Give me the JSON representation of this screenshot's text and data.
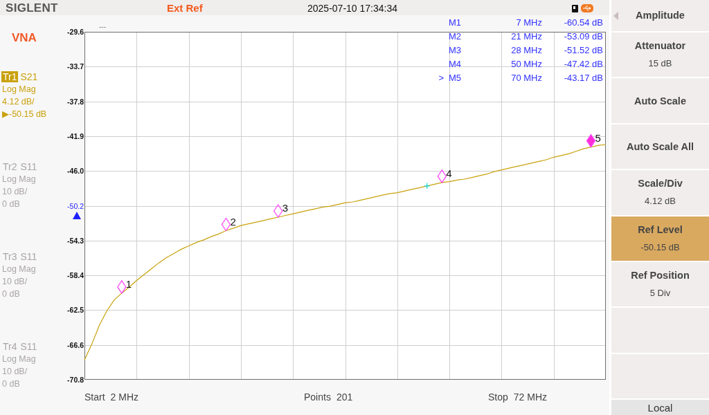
{
  "top_bar": {
    "logo": "SIGLENT",
    "reference": "Ext Ref",
    "datetime": "2025-07-10 17:34:34"
  },
  "mode": "VNA",
  "traces": [
    {
      "label": "Tr1",
      "parameter": "S21",
      "format": "Log Mag",
      "scale": "4.12 dB/",
      "reference": "▶-50.15 dB",
      "selected": true
    },
    {
      "label": "Tr2",
      "parameter": "S11",
      "format": "Log Mag",
      "scale": "10 dB/",
      "reference": "0 dB",
      "selected": false
    },
    {
      "label": "Tr3",
      "parameter": "S11",
      "format": "Log Mag",
      "scale": "10 dB/",
      "reference": "0 dB",
      "selected": false
    },
    {
      "label": "Tr4",
      "parameter": "S11",
      "format": "Log Mag",
      "scale": "10 dB/",
      "reference": "0 dB",
      "selected": false
    }
  ],
  "plot": {
    "chart_data": {
      "type": "line",
      "title": "---",
      "categories": [
        null,
        null,
        null,
        null,
        null,
        null,
        null,
        null,
        null,
        null,
        null,
        null,
        null,
        null,
        null,
        null,
        null,
        null,
        null,
        null,
        null,
        null,
        null,
        null,
        null,
        null,
        null,
        null,
        null,
        null,
        null,
        null,
        null,
        null,
        null,
        null,
        null,
        null,
        null,
        null,
        null,
        null,
        null,
        null,
        null,
        null,
        null,
        null,
        null,
        null,
        null,
        null,
        null,
        null,
        null,
        null,
        null,
        null,
        null,
        null,
        null,
        null,
        null,
        null,
        null,
        null,
        null,
        null,
        null,
        null,
        null
      ],
      "series": [
        {
          "color": "#c9a10b",
          "values": [
            -68.4,
            -66.5,
            -64.3,
            -62.6,
            -61.3,
            -60.5,
            -59.8,
            -59.0,
            -58.3,
            -57.6,
            -56.9,
            -56.3,
            -55.8,
            -55.3,
            -54.9,
            -54.5,
            -54.2,
            -53.8,
            -53.5,
            -53.1,
            -52.8,
            -52.5,
            -52.3,
            -52.1,
            -51.9,
            -51.7,
            -51.5,
            -51.3,
            -51.1,
            -50.9,
            -50.7,
            -50.5,
            -50.3,
            -50.2,
            -50.0,
            -49.8,
            -49.7,
            -49.5,
            -49.3,
            -49.1,
            -48.9,
            -48.7,
            -48.6,
            -48.4,
            -48.2,
            -48.0,
            -47.8,
            -47.6,
            -47.4,
            -47.3,
            -47.1,
            -47.0,
            -46.8,
            -46.6,
            -46.4,
            -46.1,
            -45.9,
            -45.7,
            -45.5,
            -45.3,
            -45.1,
            -44.9,
            -44.7,
            -44.4,
            -44.2,
            -44.0,
            -43.7,
            -43.4,
            -43.2,
            -43.0,
            -42.9
          ]
        },
        {
          "color": "#12d8e0",
          "marker": "cross",
          "values": [
            null,
            null,
            null,
            null,
            null,
            null,
            null,
            null,
            null,
            null,
            null,
            null,
            null,
            null,
            null,
            null,
            null,
            null,
            null,
            null,
            null,
            null,
            null,
            null,
            null,
            null,
            null,
            null,
            null,
            null,
            null,
            null,
            null,
            null,
            null,
            null,
            null,
            null,
            null,
            null,
            null,
            null,
            null,
            null,
            null,
            null,
            -47.8,
            null,
            null,
            null,
            null,
            null,
            null,
            null,
            null,
            null,
            null,
            null,
            null,
            null,
            null,
            null,
            null,
            null,
            null,
            null,
            null,
            null,
            null,
            null,
            null
          ]
        }
      ],
      "ylim": [
        -70.75,
        -29.55
      ],
      "yticks": [
        {
          "value": -29.55,
          "label": "-29.6"
        },
        {
          "value": -33.67,
          "label": "-33.7"
        },
        {
          "value": -37.79,
          "label": "-37.8"
        },
        {
          "value": -41.91,
          "label": "-41.9"
        },
        {
          "value": -46.03,
          "label": "-46.0"
        },
        {
          "value": -54.27,
          "label": "-54.3"
        },
        {
          "value": -58.39,
          "label": "-58.4"
        },
        {
          "value": -62.51,
          "label": "-62.5"
        },
        {
          "value": -66.63,
          "label": "-66.6"
        },
        {
          "value": -70.75,
          "label": "-70.8"
        }
      ],
      "grid": true,
      "ref_lines": [
        {
          "axis": "y",
          "value": -50.2,
          "label": "-50.2"
        }
      ],
      "value_labels": [
        null,
        null,
        null,
        null,
        null,
        "1",
        null,
        null,
        null,
        null,
        null,
        null,
        null,
        null,
        null,
        null,
        null,
        null,
        null,
        "2",
        null,
        null,
        null,
        null,
        null,
        null,
        "3",
        null,
        null,
        null,
        null,
        null,
        null,
        null,
        null,
        null,
        null,
        null,
        null,
        null,
        null,
        null,
        null,
        null,
        null,
        null,
        null,
        null,
        "4",
        null,
        null,
        null,
        null,
        null,
        null,
        null,
        null,
        null,
        null,
        null,
        null,
        null,
        null,
        null,
        null,
        null,
        null,
        null,
        "5",
        null,
        null
      ]
    },
    "marker_table": {
      "pointer": ">",
      "rows": [
        {
          "name": "M1",
          "frequency": "7 MHz",
          "value": "-60.54 dB",
          "selected": false
        },
        {
          "name": "M2",
          "frequency": "21 MHz",
          "value": "-53.09 dB",
          "selected": false
        },
        {
          "name": "M3",
          "frequency": "28 MHz",
          "value": "-51.52 dB",
          "selected": false
        },
        {
          "name": "M4",
          "frequency": "50 MHz",
          "value": "-47.42 dB",
          "selected": false
        },
        {
          "name": "M5",
          "frequency": "70 MHz",
          "value": "-43.17 dB",
          "selected": true
        }
      ]
    }
  },
  "sweep_info": [
    {
      "label": "Start",
      "value": "2 MHz"
    },
    {
      "label": "Points",
      "value": "201"
    },
    {
      "label": "Stop",
      "value": "72 MHz"
    }
  ],
  "softkey_menu": {
    "title": "Amplitude",
    "keys": [
      {
        "kind": "key",
        "label": "Attenuator",
        "value": "15 dB",
        "selected": false
      },
      {
        "kind": "key",
        "label": "Auto Scale",
        "selected": false
      },
      {
        "kind": "key",
        "label": "Auto Scale All",
        "selected": false
      },
      {
        "kind": "key",
        "label": "Scale/Div",
        "value": "4.12 dB",
        "selected": false
      },
      {
        "kind": "key",
        "label": "Ref Level",
        "value": "-50.15 dB",
        "selected": true
      },
      {
        "kind": "key",
        "label": "Ref Position",
        "value": "5 Div",
        "selected": false
      },
      {
        "kind": "blank",
        "selected": false
      },
      {
        "kind": "blank",
        "selected": false
      }
    ]
  },
  "status": "Local"
}
